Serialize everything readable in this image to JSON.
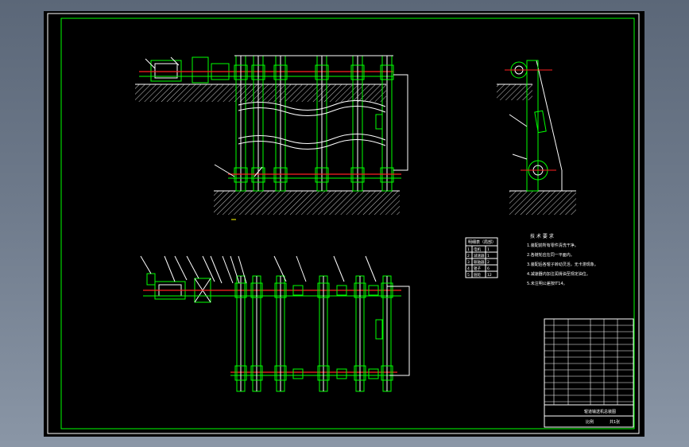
{
  "viewport": {
    "background": "#000000",
    "frame_color": "#ffffff",
    "line_colors": {
      "outline": "#00ff00",
      "detail": "#ffffff",
      "centerline": "#ff2020",
      "hatch": "#d0d0d0"
    }
  },
  "parts_table": {
    "title": "明细表（局部）",
    "rows": [
      [
        "1",
        "电机",
        "1"
      ],
      [
        "2",
        "减速器",
        "1"
      ],
      [
        "3",
        "联轴器",
        "2"
      ],
      [
        "4",
        "辊子",
        "6"
      ],
      [
        "5",
        "链轮",
        "12"
      ]
    ]
  },
  "tech_requirements": {
    "title": "技 术 要 求",
    "items": [
      "1.装配前所有零件清洗干净。",
      "2.各链轮应在同一平面内。",
      "3.装配后各辊子转动灵活，无卡滞现象。",
      "4.减速器内加注润滑油至规定油位。",
      "5.未注明公差按IT14。"
    ]
  },
  "title_block": {
    "drawing_name": "辊道输送机总装图",
    "scale_label": "比例",
    "sheet": "共1张"
  }
}
